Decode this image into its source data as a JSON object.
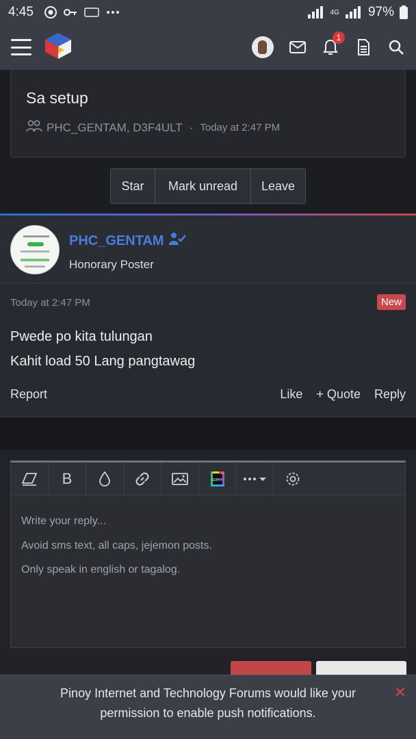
{
  "status_bar": {
    "time": "4:45",
    "network": "4G",
    "battery": "97%"
  },
  "header": {
    "notification_count": "1"
  },
  "thread_card": {
    "title": "Sa setup",
    "participants": "PHC_GENTAM, D3F4ULT",
    "separator": "·",
    "timestamp": "Today at 2:47 PM"
  },
  "thread_actions": {
    "star": "Star",
    "mark_unread": "Mark unread",
    "leave": "Leave"
  },
  "post": {
    "username": "PHC_GENTAM",
    "role": "Honorary Poster",
    "date": "Today at 2:47 PM",
    "badge": "New",
    "message_lines": [
      "Pwede po kita tulungan",
      "Kahit load 50 Lang pangtawag"
    ],
    "report": "Report",
    "like": "Like",
    "quote": "+ Quote",
    "reply": "Reply"
  },
  "editor": {
    "placeholder_lines": [
      "Write your reply...",
      "Avoid sms text, all caps, jejemon posts.",
      "Only speak in english or tagalog."
    ],
    "bold_label": "B"
  },
  "notification": {
    "line1": "Pinoy Internet and Technology Forums would like your",
    "line2": "permission to enable push notifications.",
    "close": "✕"
  },
  "colors": {
    "accent_blue": "#4a7ce0",
    "accent_red": "#c94a4e",
    "header_bg": "#3a3d46"
  }
}
